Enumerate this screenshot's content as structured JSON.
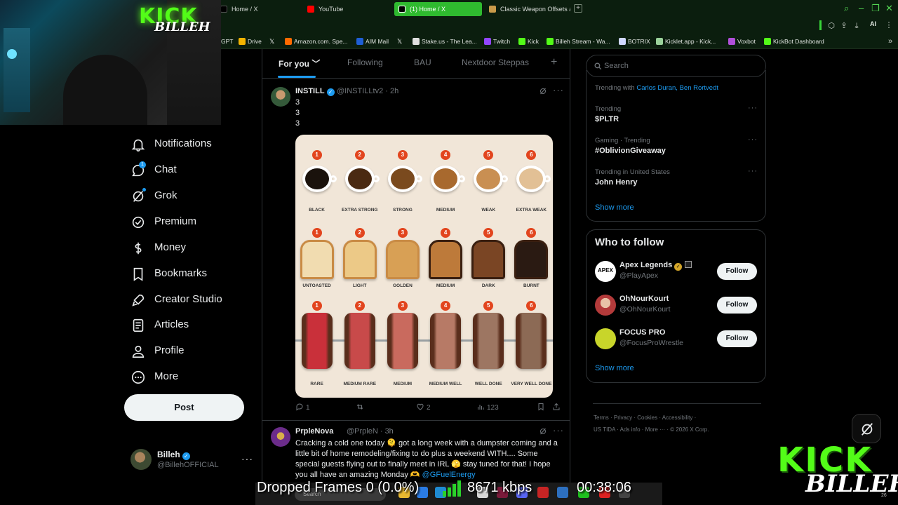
{
  "browser": {
    "tabs": [
      {
        "label": "Home / X",
        "active": false
      },
      {
        "label": "YouTube",
        "active": false
      },
      {
        "label": "(1) Home / X",
        "active": true
      },
      {
        "label": "Classic Weapon Offsets at",
        "active": false
      }
    ],
    "ai_label": "AI",
    "bookmarks": [
      {
        "label": "GPT",
        "icon": "chatgpt-icon",
        "color": "#10a37f"
      },
      {
        "label": "Drive",
        "icon": "drive-icon",
        "color": "#f4b400"
      },
      {
        "label": "",
        "icon": "x-logo-icon",
        "color": "#ffffff"
      },
      {
        "label": "Amazon.com. Spe...",
        "icon": "amazon-icon",
        "color": "#ff6a00"
      },
      {
        "label": "AIM Mail",
        "icon": "aim-icon",
        "color": "#1f5fd6"
      },
      {
        "label": "",
        "icon": "x-logo-icon",
        "color": "#ffffff"
      },
      {
        "label": "Stake.us - The Lea...",
        "icon": "stake-icon",
        "color": "#e0e0e0"
      },
      {
        "label": "Twitch",
        "icon": "twitch-icon",
        "color": "#9146ff"
      },
      {
        "label": "Kick",
        "icon": "kick-icon",
        "color": "#53fc18"
      },
      {
        "label": "Billeh Stream - Wa...",
        "icon": "kick-icon",
        "color": "#53fc18"
      },
      {
        "label": "BOTRIX",
        "icon": "botrix-icon",
        "color": "#d0d8ff"
      },
      {
        "label": "Kicklet.app - Kick...",
        "icon": "kicklet-icon",
        "color": "#9bd39b"
      },
      {
        "label": "Voxbot",
        "icon": "voxbot-icon",
        "color": "#b04fd9"
      },
      {
        "label": "KickBot Dashboard",
        "icon": "kickbot-icon",
        "color": "#53fc18"
      }
    ]
  },
  "webcam": {
    "logo_top": "KICK",
    "logo_bottom": "BILLEH"
  },
  "nav": {
    "items": [
      {
        "label": "Notifications",
        "icon": "bell-icon"
      },
      {
        "label": "Chat",
        "icon": "chat-icon",
        "badge": "1"
      },
      {
        "label": "Grok",
        "icon": "grok-icon"
      },
      {
        "label": "Premium",
        "icon": "verified-icon"
      },
      {
        "label": "Money",
        "icon": "money-icon"
      },
      {
        "label": "Bookmarks",
        "icon": "bookmark-icon"
      },
      {
        "label": "Creator Studio",
        "icon": "rocket-icon"
      },
      {
        "label": "Articles",
        "icon": "articles-icon"
      },
      {
        "label": "Profile",
        "icon": "person-icon"
      },
      {
        "label": "More",
        "icon": "more-circle-icon"
      }
    ],
    "post_label": "Post",
    "account": {
      "name": "Billeh",
      "handle": "@BillehOFFICIAL"
    }
  },
  "feed": {
    "tabs": [
      "For you",
      "Following",
      "BAU",
      "Nextdoor Steppas"
    ],
    "tweet1": {
      "name": "INSTILL",
      "handle": "@INSTILLtv2 · 2h",
      "lines": [
        "3",
        "3",
        "3"
      ],
      "image": {
        "coffee": [
          "BLACK",
          "EXTRA STRONG",
          "STRONG",
          "MEDIUM",
          "WEAK",
          "EXTRA WEAK"
        ],
        "toast": [
          "UNTOASTED",
          "LIGHT",
          "GOLDEN",
          "MEDIUM",
          "DARK",
          "BURNT"
        ],
        "steak": [
          "RARE",
          "MEDIUM RARE",
          "MEDIUM",
          "MEDIUM WELL",
          "WELL DONE",
          "VERY WELL DONE"
        ],
        "numbers": [
          "1",
          "2",
          "3",
          "4",
          "5",
          "6"
        ]
      },
      "stats": {
        "replies": "1",
        "reposts": "",
        "likes": "2",
        "views": "123"
      }
    },
    "tweet2": {
      "name": "PrpleNova",
      "handle": "@PrpleN · 3h",
      "text_main": "Cracking a cold one today 🫠 got a long week with a dumpster coming and a little bit of home remodeling/fixing to do plus a weekend WITH.... Some special guests flying out to finally meet in IRL 🫣 stay tuned for that! I hope you all have an amazing Monday 🫶 ",
      "mention": "@GFuelEnergy"
    }
  },
  "right": {
    "search_placeholder": "Search",
    "trends": [
      {
        "meta": "Trending with",
        "links": "Carlos Duran, Ben Rortvedt",
        "title": ""
      },
      {
        "meta": "Trending",
        "title": "$PLTR"
      },
      {
        "meta": "Gaming · Trending",
        "title": "#OblivionGiveaway"
      },
      {
        "meta": "Trending in United States",
        "title": "John Henry"
      }
    ],
    "show_more": "Show more",
    "who_to_follow": {
      "title": "Who to follow",
      "accounts": [
        {
          "name": "Apex Legends",
          "handle": "@PlayApex",
          "button": "Follow"
        },
        {
          "name": "OhNourKourt",
          "handle": "@OhNourKourt",
          "button": "Follow"
        },
        {
          "name": "FOCUS PRO",
          "handle": "@FocusProWrestle",
          "button": "Follow"
        }
      ],
      "show_more": "Show more"
    },
    "footer": {
      "row1": "Terms  ·  Privacy  ·  Cookies  ·  Accessibility  ·",
      "row2": "US TIDA  ·  Ads info  ·  More ···  ·  © 2026 X Corp."
    }
  },
  "overlay": {
    "dropped_frames": "Dropped Frames 0 (0.0%)",
    "bitrate": "8671 kbps",
    "timer": "00:38:06",
    "logo_top": "KICK",
    "logo_bottom": "BILLEH",
    "year": "26",
    "taskbar_search": "Search"
  }
}
